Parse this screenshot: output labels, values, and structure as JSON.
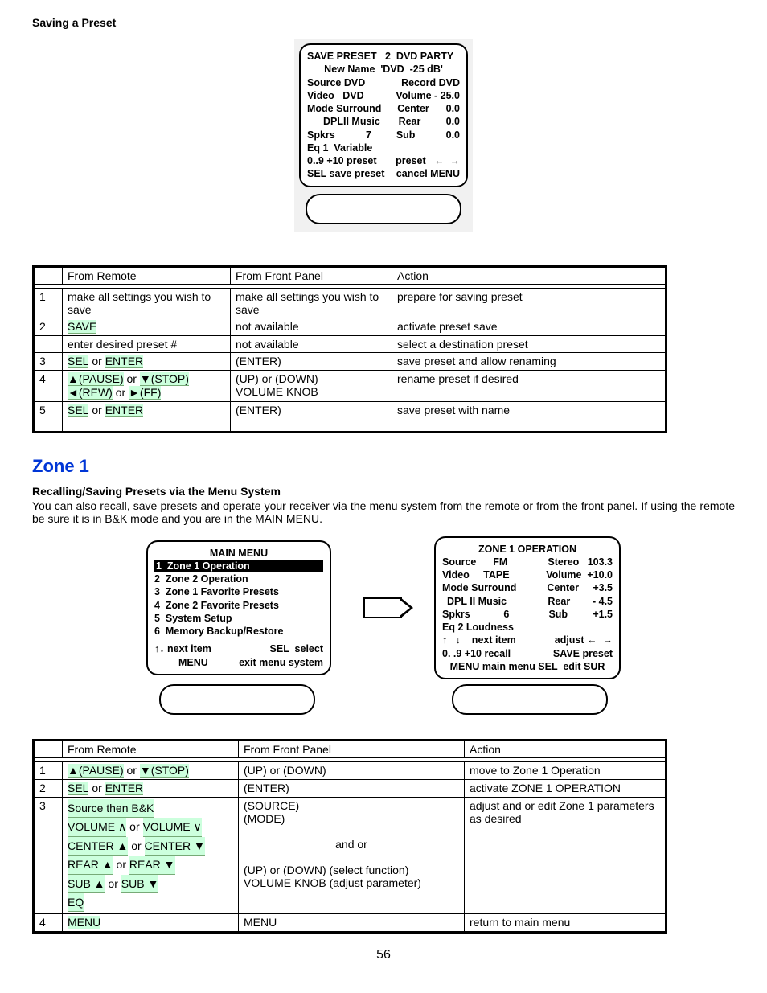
{
  "page": {
    "number": "56"
  },
  "saving": {
    "title": "Saving a Preset",
    "lcd": {
      "l1a": "SAVE PRESET   2  DVD PARTY",
      "l2a": "New Name  'DVD  -25 dB'",
      "l3a": "Source DVD",
      "l3b": "Record DVD",
      "l4a": "Video   DVD",
      "l4b": "Volume - 25.0",
      "l5a": "Mode Surround",
      "l5b": "Center      0.0",
      "l6a": "DPLII Music",
      "l6b": "Rear         0.0",
      "l7a": "Spkrs           7",
      "l7b": "Sub           0.0",
      "l8a": "Eq 1  Variable",
      "l9a": "0..9 +10 preset",
      "l9b": "preset   ←  →",
      "l10a": "SEL save preset",
      "l10b": "cancel MENU"
    },
    "table": {
      "h1": "From Remote",
      "h2": "From Front Panel",
      "h3": "Action",
      "r1": {
        "n": "1",
        "a": "make all settings you wish to save",
        "b": "make all settings you wish to save",
        "c": "prepare for saving preset"
      },
      "r2": {
        "n": "2",
        "a": "SAVE",
        "b": "not available",
        "c": "activate preset save"
      },
      "r2b": {
        "a": "enter desired preset #",
        "b": "not available",
        "c": "select a destination preset"
      },
      "r3": {
        "n": "3",
        "a_pre": "SEL",
        "a_mid": " or ",
        "a_post": "ENTER",
        "b": "(ENTER)",
        "c": "save preset and allow renaming"
      },
      "r4": {
        "n": "4",
        "a1_pre": "▲(PAUSE)",
        "a1_mid": " or ",
        "a1_post": "▼(STOP)",
        "a2_pre": "◄(REW)",
        "a2_mid": " or ",
        "a2_post": "►(FF)",
        "b": "(UP) or (DOWN)\nVOLUME KNOB",
        "c": "rename preset if desired"
      },
      "r5": {
        "n": "5",
        "a_pre": "SEL",
        "a_mid": " or ",
        "a_post": "ENTER",
        "b": "(ENTER)",
        "c": "save preset with name"
      }
    }
  },
  "zone": {
    "heading": "Zone 1",
    "subtitle": "Recalling/Saving Presets via the Menu System",
    "para": "You can also recall, save presets and operate your receiver via the menu system from the remote or from the front panel. If using the remote be sure it is in B&K mode and you are in the MAIN MENU.",
    "main_menu": {
      "title": "MAIN MENU",
      "i1": "1  Zone 1 Operation",
      "i2": "2  Zone 2 Operation",
      "i3": "3  Zone 1 Favorite Presets",
      "i4": "4  Zone 2 Favorite Presets",
      "i5": "5  System Setup",
      "i6": "6  Memory Backup/Restore",
      "f1a": "↑↓ next item",
      "f1b": "SEL  select",
      "f2a": "MENU",
      "f2b": "exit menu system"
    },
    "op_menu": {
      "title": "ZONE 1 OPERATION",
      "r1a": "Source      FM",
      "r1b": "Stereo   103.3",
      "r2a": "Video     TAPE",
      "r2b": "Volume  +10.0",
      "r3a": "Mode Surround",
      "r3b": "Center     +3.5",
      "r4a": "DPL II Music",
      "r4b": "Rear        - 4.5",
      "r5a": "Spkrs            6",
      "r5b": "Sub         +1.5",
      "r6a": "Eq 2 Loudness",
      "r7a": "↑   ↓    next item",
      "r7b": "adjust ←  →",
      "r8a": "0. .9 +10 recall",
      "r8b": "SAVE preset",
      "r9a": "MENU main menu SEL  edit SUR"
    },
    "table": {
      "h1": "From Remote",
      "h2": "From Front Panel",
      "h3": "Action",
      "r1": {
        "n": "1",
        "a_pre": "▲(PAUSE)",
        "a_mid": " or ",
        "a_post": "▼(STOP)",
        "b": "(UP) or (DOWN)",
        "c": "move to Zone 1 Operation"
      },
      "r2": {
        "n": "2",
        "a_pre": "SEL",
        "a_mid": " or ",
        "a_post": "ENTER",
        "b": "(ENTER)",
        "c": "activate ZONE 1 OPERATION"
      },
      "r3": {
        "n": "3",
        "l1": "Source then B&K",
        "l2_pre": "VOLUME ∧",
        "l2_mid": " or ",
        "l2_post": "VOLUME ∨",
        "l3_pre": "CENTER ▲",
        "l3_mid": " or ",
        "l3_post": "CENTER ▼",
        "l4_pre": "REAR ▲",
        "l4_mid": " or ",
        "l4_post": "REAR ▼",
        "l5_pre": "SUB ▲",
        "l5_mid": " or ",
        "l5_post": "SUB ▼",
        "l6": "EQ",
        "b1": "(SOURCE)",
        "b2": "(MODE)",
        "b3": "and or",
        "b4": "(UP) or (DOWN) (select function)",
        "b5": "VOLUME KNOB (adjust parameter)",
        "c": "adjust and or edit Zone 1 parameters as desired"
      },
      "r4": {
        "n": "4",
        "a": "MENU",
        "b": "MENU",
        "c": "return to main menu"
      }
    }
  }
}
